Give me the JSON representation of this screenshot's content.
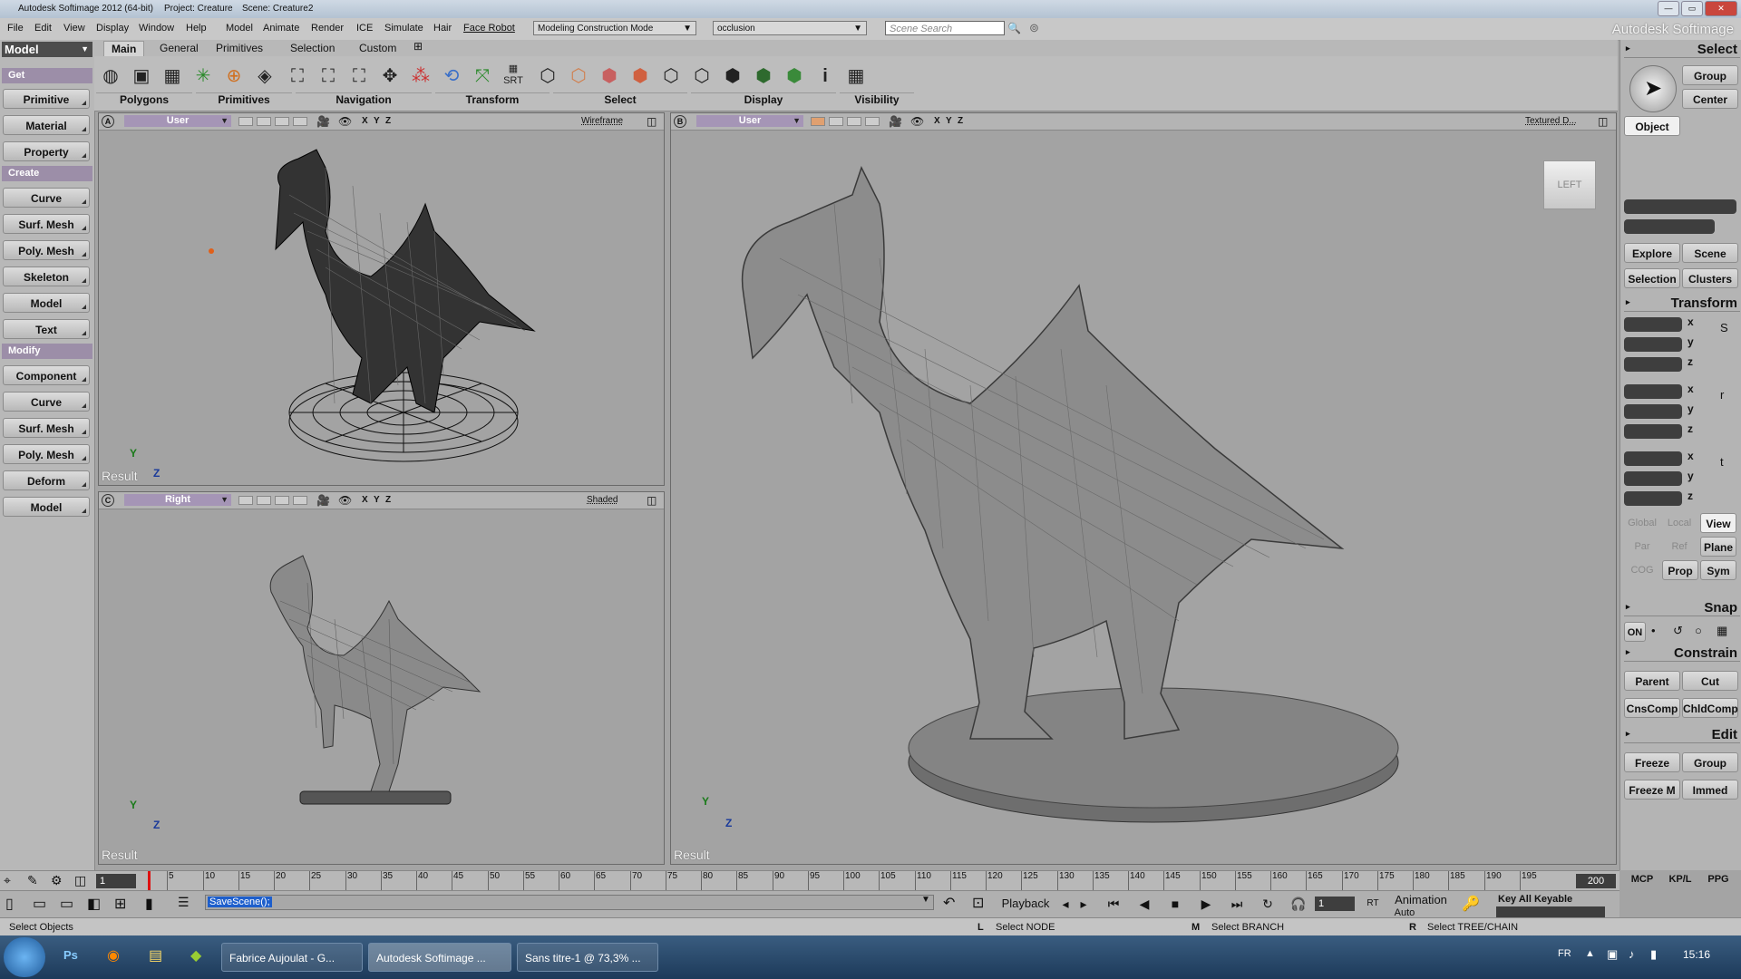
{
  "titlebar": {
    "app": "Autodesk Softimage 2012 (64-bit)",
    "project": "Project: Creature",
    "scene": "Scene: Creature2"
  },
  "menu": {
    "items": [
      "File",
      "Edit",
      "View",
      "Display",
      "Window",
      "Help",
      "Model",
      "Animate",
      "Render",
      "ICE",
      "Simulate",
      "Hair",
      "Face Robot"
    ],
    "mode_combo": "Modeling Construction Mode",
    "pass_combo": "occlusion",
    "search_placeholder": "Scene Search",
    "brand": "Autodesk Softimage"
  },
  "left": {
    "module": "Model",
    "get_header": "Get",
    "get_items": [
      "Primitive",
      "Material",
      "Property"
    ],
    "create_header": "Create",
    "create_items": [
      "Curve",
      "Surf. Mesh",
      "Poly. Mesh",
      "Skeleton",
      "Model",
      "Text"
    ],
    "modify_header": "Modify",
    "modify_items": [
      "Component",
      "Curve",
      "Surf. Mesh",
      "Poly. Mesh",
      "Deform",
      "Model"
    ]
  },
  "tabs": [
    "Main",
    "General",
    "Primitives",
    "Selection",
    "Custom"
  ],
  "toolbar_groups": [
    "Polygons",
    "Primitives",
    "Navigation",
    "Transform",
    "Select",
    "Display",
    "Visibility"
  ],
  "toolbar_srt": "SRT",
  "viewports": {
    "a": {
      "letter": "A",
      "camera": "User",
      "mode": "Wireframe",
      "result": "Result"
    },
    "b": {
      "letter": "B",
      "camera": "User",
      "mode": "Textured D...",
      "result": "Result",
      "cube": "LEFT"
    },
    "c": {
      "letter": "C",
      "camera": "Right",
      "mode": "Shaded",
      "result": "Result"
    },
    "xyz": [
      "X",
      "Y",
      "Z"
    ],
    "axis_y": "Y",
    "axis_z": "Z"
  },
  "right": {
    "select_header": "Select",
    "group": "Group",
    "center": "Center",
    "object": "Object",
    "explore": "Explore",
    "scene": "Scene",
    "selection": "Selection",
    "clusters": "Clusters",
    "transform_header": "Transform",
    "axes": [
      "x",
      "y",
      "z"
    ],
    "global": "Global",
    "local": "Local",
    "view": "View",
    "par": "Par",
    "ref": "Ref",
    "plane": "Plane",
    "cog": "COG",
    "prop": "Prop",
    "sym": "Sym",
    "snap_header": "Snap",
    "on": "ON",
    "constrain_header": "Constrain",
    "parent": "Parent",
    "cut": "Cut",
    "cnscomp": "CnsComp",
    "chldcomp": "ChldComp",
    "edit_header": "Edit",
    "freeze": "Freeze",
    "group2": "Group",
    "freezem": "Freeze M",
    "immed": "Immed",
    "mcp": "MCP",
    "kplo": "KP/L",
    "ppg": "PPG",
    "keyall": "Key All Keyable"
  },
  "timeline": {
    "start": "1",
    "end": "200",
    "ticks": [
      "5",
      "10",
      "15",
      "20",
      "25",
      "30",
      "35",
      "40",
      "45",
      "50",
      "55",
      "60",
      "65",
      "70",
      "75",
      "80",
      "85",
      "90",
      "95",
      "100",
      "105",
      "110",
      "115",
      "120",
      "125",
      "130",
      "135",
      "140",
      "145",
      "150",
      "155",
      "160",
      "165",
      "170",
      "175",
      "180",
      "185",
      "190",
      "195"
    ]
  },
  "playback": {
    "command": "SaveScene();",
    "playback": "Playback",
    "frame": "1",
    "rt": "RT",
    "animation": "Animation",
    "auto": "Auto"
  },
  "status": {
    "message": "Select Objects",
    "l_key": "L",
    "l_text": "Select NODE",
    "m_key": "M",
    "m_text": "Select BRANCH",
    "r_key": "R",
    "r_text": "Select TREE/CHAIN"
  },
  "taskbar": {
    "tasks": [
      "Fabrice Aujoulat - G...",
      "Autodesk Softimage ...",
      "Sans titre-1 @ 73,3% ..."
    ],
    "lang": "FR",
    "time": "15:16"
  }
}
